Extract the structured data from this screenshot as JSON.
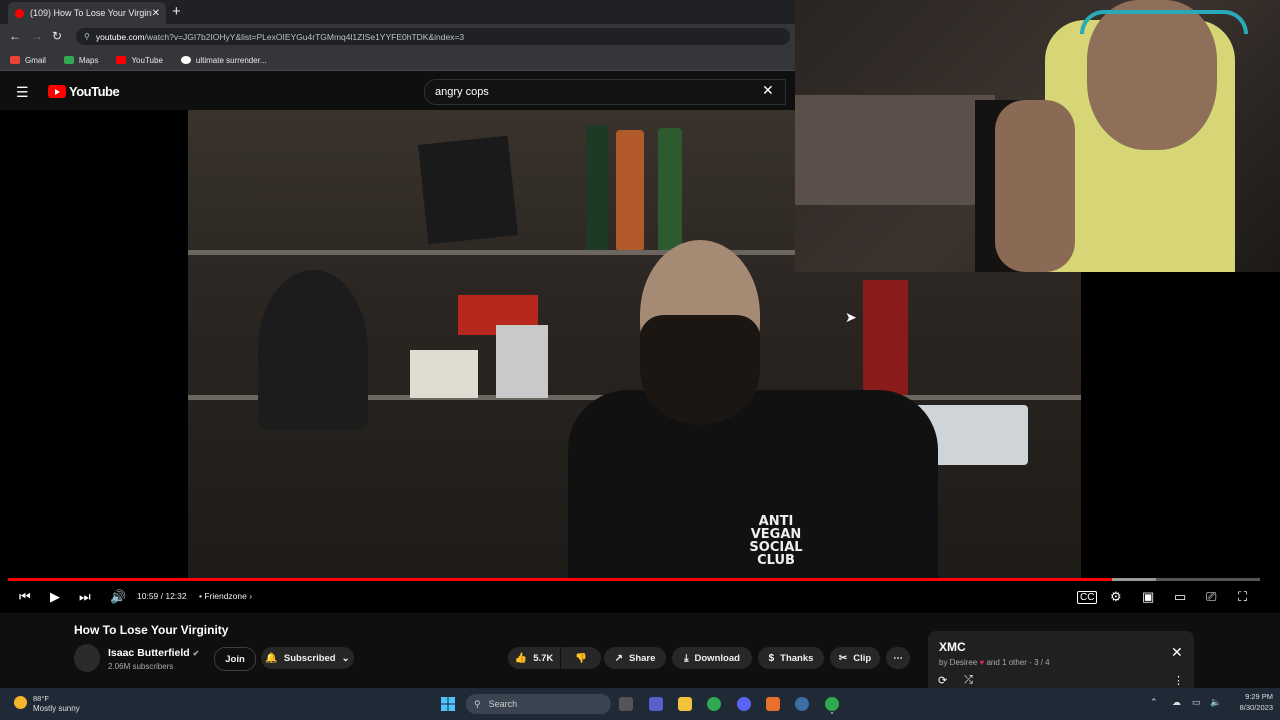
{
  "browser": {
    "tab_title": "(109) How To Lose Your Virginity",
    "url_domain": "youtube.com",
    "url_path": "/watch?v=JGI7b2IOHyY&list=PLexOIEYGu4rTGMmq4l1ZISe1YYFE0hTDK&index=3",
    "bookmarks": [
      "Gmail",
      "Maps",
      "YouTube",
      "ultimate surrender..."
    ]
  },
  "youtube": {
    "logo_text": "YouTube",
    "search_value": "angry cops"
  },
  "player": {
    "progress_fraction": 0.882,
    "time": "10:59 / 12:32",
    "chapter": "Friendzone",
    "shirt_text": "ANTI VEGAN SOCIAL CLUB"
  },
  "video": {
    "title": "How To Lose Your Virginity",
    "channel": "Isaac Butterfield",
    "subscribers": "2.06M subscribers",
    "join": "Join",
    "subscribed": "Subscribed",
    "likes": "5.7K",
    "share": "Share",
    "download": "Download",
    "thanks": "Thanks",
    "clip": "Clip"
  },
  "playlist": {
    "title": "XMC",
    "by": "by Desiree",
    "others": "and 1 other",
    "position": "3 / 4"
  },
  "taskbar": {
    "weather_temp": "88°F",
    "weather_desc": "Mostly sunny",
    "search": "Search",
    "time": "9:29 PM",
    "date": "8/30/2023"
  },
  "colors": {
    "accent": "#ff0000",
    "background": "#0f0f0f",
    "taskbar": "#1f2a36"
  }
}
